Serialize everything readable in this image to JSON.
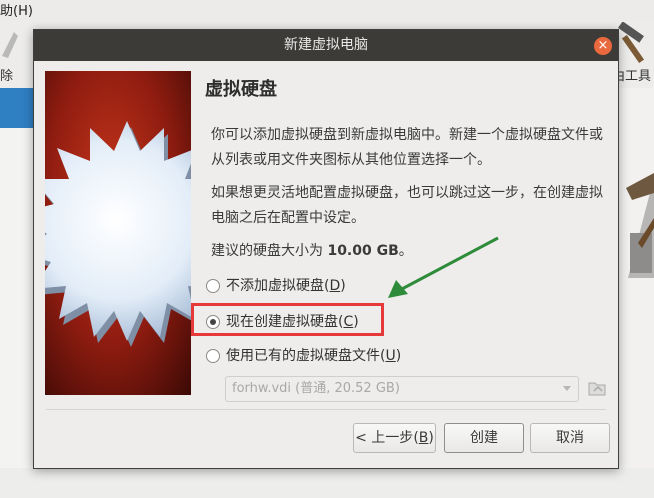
{
  "background": {
    "menu_fragment": "助(H)",
    "toolbar_left_fragment": "除",
    "toolbar_left_fragment2": "启",
    "toolbar_right_fragment": "由工具"
  },
  "dialog": {
    "title": "新建虚拟电脑",
    "heading": "虚拟硬盘",
    "paragraph1": "你可以添加虚拟硬盘到新虚拟电脑中。新建一个虚拟硬盘文件或从列表或用文件夹图标从其他位置选择一个。",
    "paragraph2": "如果想更灵活地配置虚拟硬盘，也可以跳过这一步，在创建虚拟电脑之后在配置中设定。",
    "recommended_prefix": "建议的硬盘大小为 ",
    "recommended_size": "10.00 GB",
    "recommended_suffix": "。",
    "options": [
      {
        "label": "不添加虚拟硬盘",
        "key": "D",
        "checked": false
      },
      {
        "label": "现在创建虚拟硬盘",
        "key": "C",
        "checked": true
      },
      {
        "label": "使用已有的虚拟硬盘文件",
        "key": "U",
        "checked": false
      }
    ],
    "existing_file": "forhw.vdi (普通, 20.52 GB)",
    "buttons": {
      "back_label": "< 上一步",
      "back_key": "B",
      "create_label": "创建",
      "cancel_label": "取消"
    },
    "annotation_color": "#e63a3a",
    "arrow_color": "#2e8b3a"
  }
}
